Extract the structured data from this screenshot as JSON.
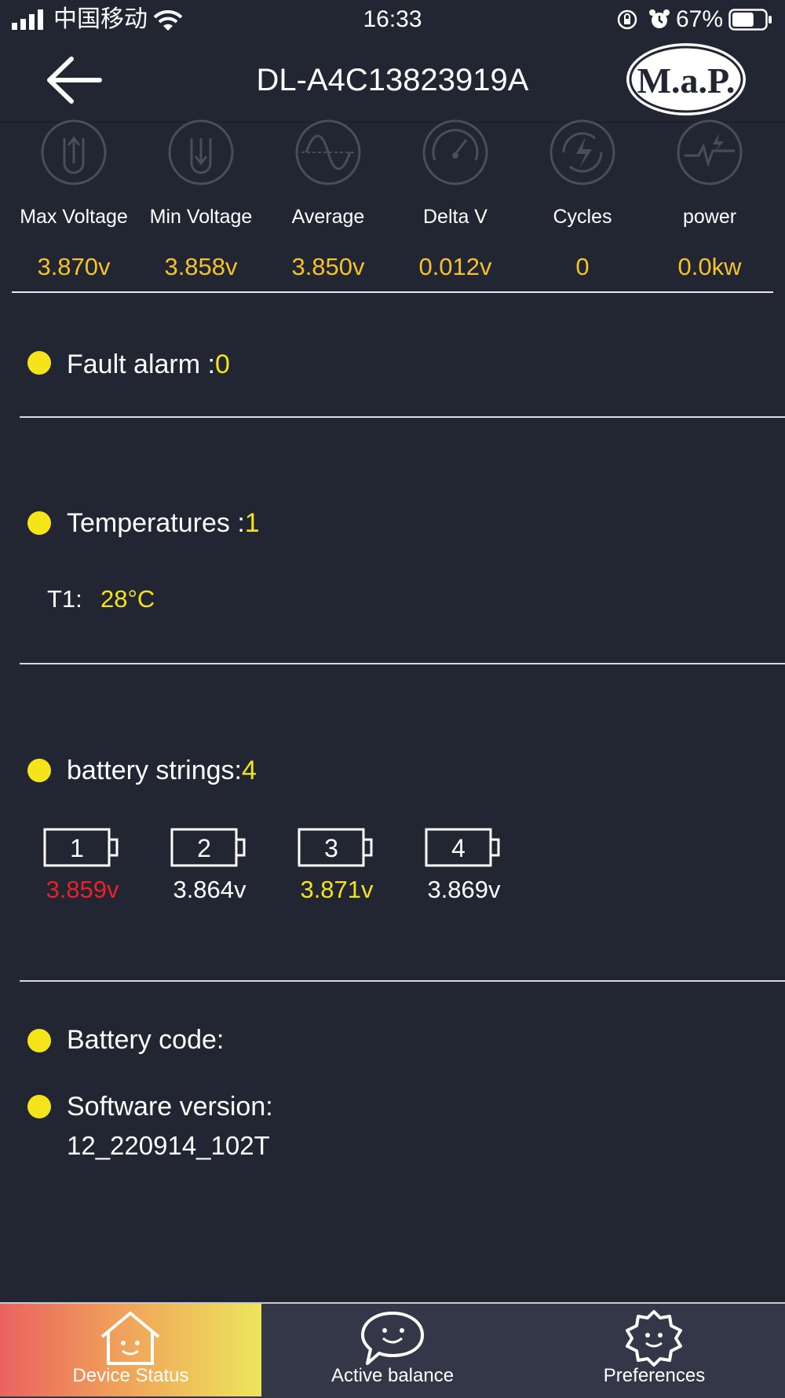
{
  "status_bar": {
    "carrier": "中国移动",
    "time": "16:33",
    "battery_percent": "67%",
    "battery_level": 0.67
  },
  "header": {
    "title": "DL-A4C13823919A",
    "logo_text": "M.a.P."
  },
  "stats": [
    {
      "label": "Max Voltage",
      "value": "3.870v",
      "icon": "max-voltage-icon"
    },
    {
      "label": "Min Voltage",
      "value": "3.858v",
      "icon": "min-voltage-icon"
    },
    {
      "label": "Average",
      "value": "3.850v",
      "icon": "sine-wave-icon"
    },
    {
      "label": "Delta V",
      "value": "0.012v",
      "icon": "gauge-icon"
    },
    {
      "label": "Cycles",
      "value": "0",
      "icon": "cycle-charge-icon"
    },
    {
      "label": "power",
      "value": "0.0kw",
      "icon": "pulse-icon"
    }
  ],
  "fault": {
    "label": "Fault alarm :",
    "count": "0"
  },
  "temperatures": {
    "label": "Temperatures :",
    "count": "1",
    "items": [
      {
        "label": "T1:",
        "value": "28°C"
      }
    ]
  },
  "battery_strings": {
    "label": "battery strings:",
    "count": "4",
    "cells": [
      {
        "index": "1",
        "voltage": "3.859v",
        "color": "#e8222a"
      },
      {
        "index": "2",
        "voltage": "3.864v",
        "color": "#ffffff"
      },
      {
        "index": "3",
        "voltage": "3.871v",
        "color": "#f5e41a"
      },
      {
        "index": "4",
        "voltage": "3.869v",
        "color": "#ffffff"
      }
    ]
  },
  "battery_code": {
    "label": "Battery code:"
  },
  "software_version": {
    "label": "Software version:",
    "value": "12_220914_102T"
  },
  "tabs": [
    {
      "label": "Device Status",
      "icon": "house-smile-icon",
      "active": true
    },
    {
      "label": "Active balance",
      "icon": "chat-bubble-smile-icon",
      "active": false
    },
    {
      "label": "Preferences",
      "icon": "gear-smile-icon",
      "active": false
    }
  ],
  "colors": {
    "background": "#222532",
    "accent_yellow": "#f5e41a",
    "value_orange": "#f5c22a",
    "alert_red": "#e8222a",
    "tabbar": "#333748"
  }
}
